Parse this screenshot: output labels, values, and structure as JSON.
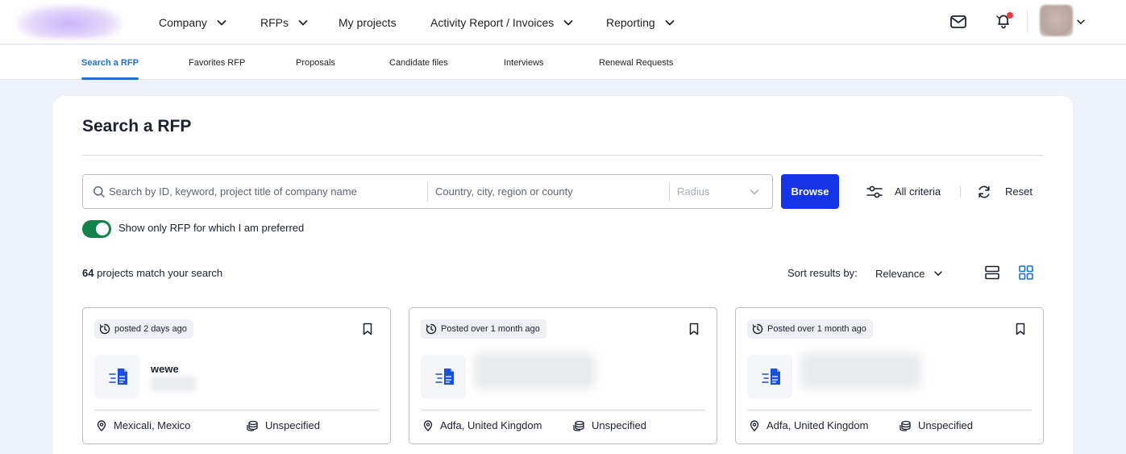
{
  "nav": {
    "items": [
      {
        "label": "Company",
        "has_dropdown": true
      },
      {
        "label": "RFPs",
        "has_dropdown": true
      },
      {
        "label": "My projects",
        "has_dropdown": false
      },
      {
        "label": "Activity Report / Invoices",
        "has_dropdown": true
      },
      {
        "label": "Reporting",
        "has_dropdown": true
      }
    ]
  },
  "subnav": {
    "tabs": [
      {
        "label": "Search a RFP",
        "active": true
      },
      {
        "label": "Favorites RFP"
      },
      {
        "label": "Proposals"
      },
      {
        "label": "Candidate files"
      },
      {
        "label": "Interviews"
      },
      {
        "label": "Renewal Requests"
      }
    ]
  },
  "page": {
    "title": "Search a RFP"
  },
  "search": {
    "keyword_placeholder": "Search by ID, keyword, project title of company name",
    "keyword_value": "",
    "location_placeholder": "Country, city, region or county",
    "location_value": "",
    "radius_placeholder": "Radius",
    "browse_label": "Browse",
    "criteria_label": "All criteria",
    "reset_label": "Reset"
  },
  "filter": {
    "preferred_toggle_on": true,
    "preferred_label": "Show only RFP for which I am preferred"
  },
  "results": {
    "count": "64",
    "count_suffix": "projects match your search",
    "sort_label": "Sort results by:",
    "sort_value": "Relevance",
    "view_mode": "grid"
  },
  "cards": [
    {
      "posted": "posted 2 days ago",
      "title": "wewe",
      "location": "Mexicali, Mexico",
      "budget": "Unspecified"
    },
    {
      "posted": "Posted over 1 month ago",
      "title": "",
      "location": "Adfa, United Kingdom",
      "budget": "Unspecified"
    },
    {
      "posted": "Posted over 1 month ago",
      "title": "",
      "location": "Adfa, United Kingdom",
      "budget": "Unspecified"
    }
  ],
  "colors": {
    "accent": "#1f6fd8",
    "primary_button": "#1434e6",
    "toggle_on": "#128248",
    "notification_dot": "#ef3b3b",
    "page_bg": "#eef3fb"
  }
}
